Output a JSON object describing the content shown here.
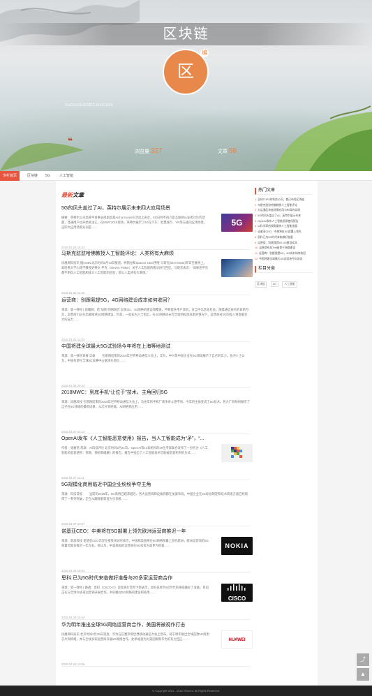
{
  "hero": {
    "title": "区块链",
    "avatar_char": "区",
    "badge": "编",
    "subtitle": "SUCCESS.KEMEX.SUCCESS",
    "quote": "❝",
    "stat1_label": "浏览量",
    "stat1_value": "327",
    "stat2_label": "文章",
    "stat2_value": "58"
  },
  "nav": {
    "tabs": [
      "专栏首页",
      "区块链",
      "5G",
      "人工智能"
    ]
  },
  "main": {
    "latest_label_prefix": "最新",
    "latest_label_suffix": "文章",
    "articles": [
      {
        "title": "5G的风头盖过了AI，英特尔展示未来四大应用场景",
        "desc": "摘要：英特尔公司高管平台事业部副总裁Aicha Evans在活动上表示，5G已经不再只是互联网从业者讨论的话题，普通用户也开始关注它。在MWC2018现场，英特尔展示了5G在汽车、智慧城市、VR等方面的应用场景，这四大应用场景分别是……",
        "time": "2018.02.26 16:43",
        "thumb": "5G"
      },
      {
        "title": "马斯克怼怼哈佛教授人工智能评论：人类将有大麻烦",
        "desc": "凤凰网科技讯 据CNBC北京时间2月23日报道，特斯拉和SpaceX CEO伊隆·马斯克(Elon Musk)昨日在推特上，就哈佛大学心理学教授史蒂文·平克（Steven Pinker）关于人工智能的看法进行回应。马斯克表示：“如果连平克都不明白人工智能和狭义人工智能的区别，那么人类将有大麻烦。”",
        "time": "2018.02.02 11:30",
        "thumb": "face"
      },
      {
        "title": "运营商：别跟我提5G，4G网络建设成本如何收回？",
        "desc": "来源：第一财经 | 前瞻网：哈“加快”四网融合 加快3G、4G网络的建设和覆盖，不断提升用户体验，在当今信息化社会，随着通信技术的日新月异，运营商们正在加紧推进5G网络建设。但是，一些业内人士指出，在4G网络尚未完全收回投资成本的情况下，运营商对5G的投入将面临巨大的压力……",
        "time": "2018.03.01 11:53",
        "thumb": ""
      },
      {
        "title": "中国将建全球最大5G试验场今年将在上海等地测试",
        "desc": "来源：第一财经日报 华泰 　　在刚刚结束的2018年世界移动通信大会上，华为、中兴等中国企业在5G领域展示了自己的实力。业内人士认为，中国有望在全球5G竞赛中占据领先地位……",
        "time": "2018.02.26 20:43",
        "thumb": ""
      },
      {
        "title": "2018MWC：到底手机“让位于”技术，主角回归5G",
        "desc": "来源：凤凰科技 在刚刚结束的2018年世界移动通信大会上，与往年的手机厂商争奇斗艳不同，今年的主角变成了5G技术。各大厂商纷纷展示了自己在5G领域的最新成果，从芯片到终端，从网络到应用……",
        "time": "2018.02.27 02:12",
        "thumb": ""
      },
      {
        "title": "OpenAI发布《人工智能恶意使用》报告，当人工智能成为“矛”，“...",
        "desc": "作者：张嘉铭 来源：AI科技评论 北京时间2月21日，OpenAI等14家机构的26位专家联合发布了一份名为《人工智能的恶意使用：预测、预防和缓解》的报告，报告中指出了人工智能技术可能被恶意利用的方式……",
        "time": "2018.02.27 11:11",
        "thumb": "pix"
      },
      {
        "title": "5G规模化商用临近中国企业纷纷争夺主角",
        "desc": "来源：科技日报 　　当前的2018年，5G商用已越来越近，各大运营商和设备商都在加紧布局。中国企业在5G标准制定和技术研发方面已经取得了一系列突破，正在从跟随者转变为引领者……",
        "time": "2018.02.27 10:47",
        "thumb": ""
      },
      {
        "title": "诺基亚CEO：中美将在5G部署上领先欧洲运营商推迟一年",
        "desc": "来源：新浪科技 诺基亚CEO苏里在接受采访时表示，中国和美国将在5G网络部署上领先欧洲，欧洲运营商的5G部署可能会推迟一年左右。他认为，中美两国的运营商在5G投资方面更为积极……",
        "time": "2018.02.26 18:03",
        "thumb": "NOKIA"
      },
      {
        "title": "思科:已为5G时代来临做好准备与20多家运营商合作",
        "desc": "来源：第一财经 | 路透：思科（CSCO.O）首席执行官罗卞斯表示，思科已经为5G时代的来临做好了准备，目前正在与全球20多家运营商开展合作，共同推动5G网络的建设和商用……",
        "time": "2018.02.26 10:44",
        "thumb": "CISCO"
      },
      {
        "title": "华为明年推出全球5G网络运营商合作，美国将被视作打击",
        "desc": "凤凰网科技讯 北京时间2月26日消息，华为在巴塞罗那世界移动通信大会上宣布，将于明年推出全球首款5G商用芯片和终端，并与全球多家运营商开展5G网络合作。此举被视为对美国限制华为的有力回应……",
        "time": "2018.02.26 10:56",
        "thumb": "HUAWEI"
      }
    ]
  },
  "sidebar": {
    "hot_title": "热门文章",
    "hot_items": [
      "全球TOP5的科技公司，都已布局区块链",
      "乌斯克怼怼哈佛教授人工智能评论",
      "大运通区块链场景应用与布局的实践",
      "5G的风头盖过了AI，英特尔展示未来",
      "OpenAI发布人工智能恶意使用报告",
      "以科学家的视角看待人工智能发展",
      "诺基亚CEO：中美将在5G部署上领先",
      "思科已为5G时代来临做好准备",
      "运营商：别跟我提5G 4G建设成本",
      "运营商布局Tbit级骨干网络建设",
      "运营商：别跟我提5G，4G成本如何收回",
      "中国将建全球最大5G试验场今年测试"
    ],
    "tags_title": "栏目分类",
    "tags": [
      "区块链",
      "5G",
      "人工智能"
    ]
  },
  "footer": {
    "copyright": "© Copyright 2001 - 2018 Tencent. All Rights Reserved."
  },
  "float": {
    "share": "⤴",
    "top": "▲"
  }
}
